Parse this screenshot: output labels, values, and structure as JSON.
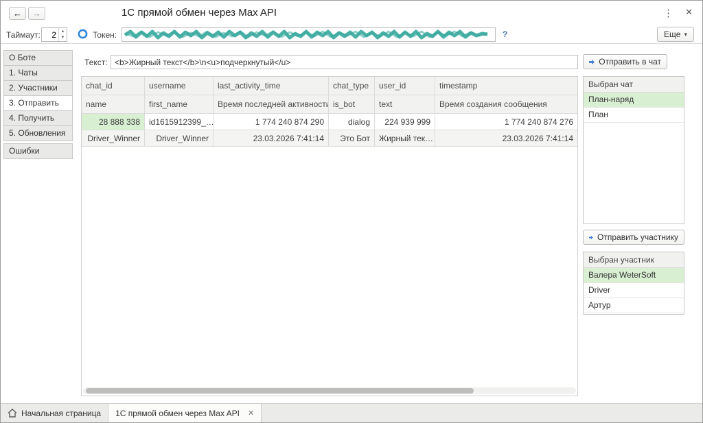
{
  "window": {
    "title": "1С прямой обмен через Max API"
  },
  "icons": {
    "back": "←",
    "forward": "→",
    "kebab": "⋮",
    "close": "✕",
    "spin_up": "▲",
    "spin_down": "▼",
    "help": "?",
    "more_caret": "▾",
    "tab_close": "✕"
  },
  "toolbar": {
    "timeout_label": "Таймаут:",
    "timeout_value": "2",
    "token_label": "Токен:",
    "more_button": "Еще"
  },
  "sidebar": {
    "items": [
      {
        "label": "О Боте"
      },
      {
        "label": "1. Чаты"
      },
      {
        "label": "2. Участники"
      },
      {
        "label": "3. Отправить"
      },
      {
        "label": "4. Получить"
      },
      {
        "label": "5. Обновления"
      },
      {
        "label": "Ошибки"
      }
    ]
  },
  "main": {
    "text_label": "Текст:",
    "text_value": "<b>Жирный текст</b>\\n<u>подчеркнутый</u>",
    "table": {
      "header_row1": [
        "chat_id",
        "username",
        "last_activity_time",
        "chat_type",
        "user_id",
        "timestamp"
      ],
      "header_row2": [
        "name",
        "first_name",
        "Время последней активности",
        "is_bot",
        "text",
        "Время создания сообщения"
      ],
      "rows": [
        [
          "28 888 338",
          "id1615912399_…",
          "1 774 240 874 290",
          "dialog",
          "224 939 999",
          "1 774 240 874 276"
        ],
        [
          "Driver_Winner",
          "Driver_Winner",
          "23.03.2026 7:41:14",
          "Это Бот",
          "Жирный тек…",
          "23.03.2026 7:41:14"
        ]
      ]
    }
  },
  "right_panel": {
    "send_chat_button": "Отправить в чат",
    "chat_list_title": "Выбран чат",
    "chats": [
      {
        "label": "План-наряд"
      },
      {
        "label": "План"
      }
    ],
    "send_member_button": "Отправить участнику",
    "member_list_title": "Выбран участник",
    "members": [
      {
        "label": "Валера WeterSoft"
      },
      {
        "label": "Driver"
      },
      {
        "label": "Артур"
      }
    ]
  },
  "taskbar": {
    "home_tab": "Начальная страница",
    "active_tab": "1С прямой обмен через Max API"
  }
}
